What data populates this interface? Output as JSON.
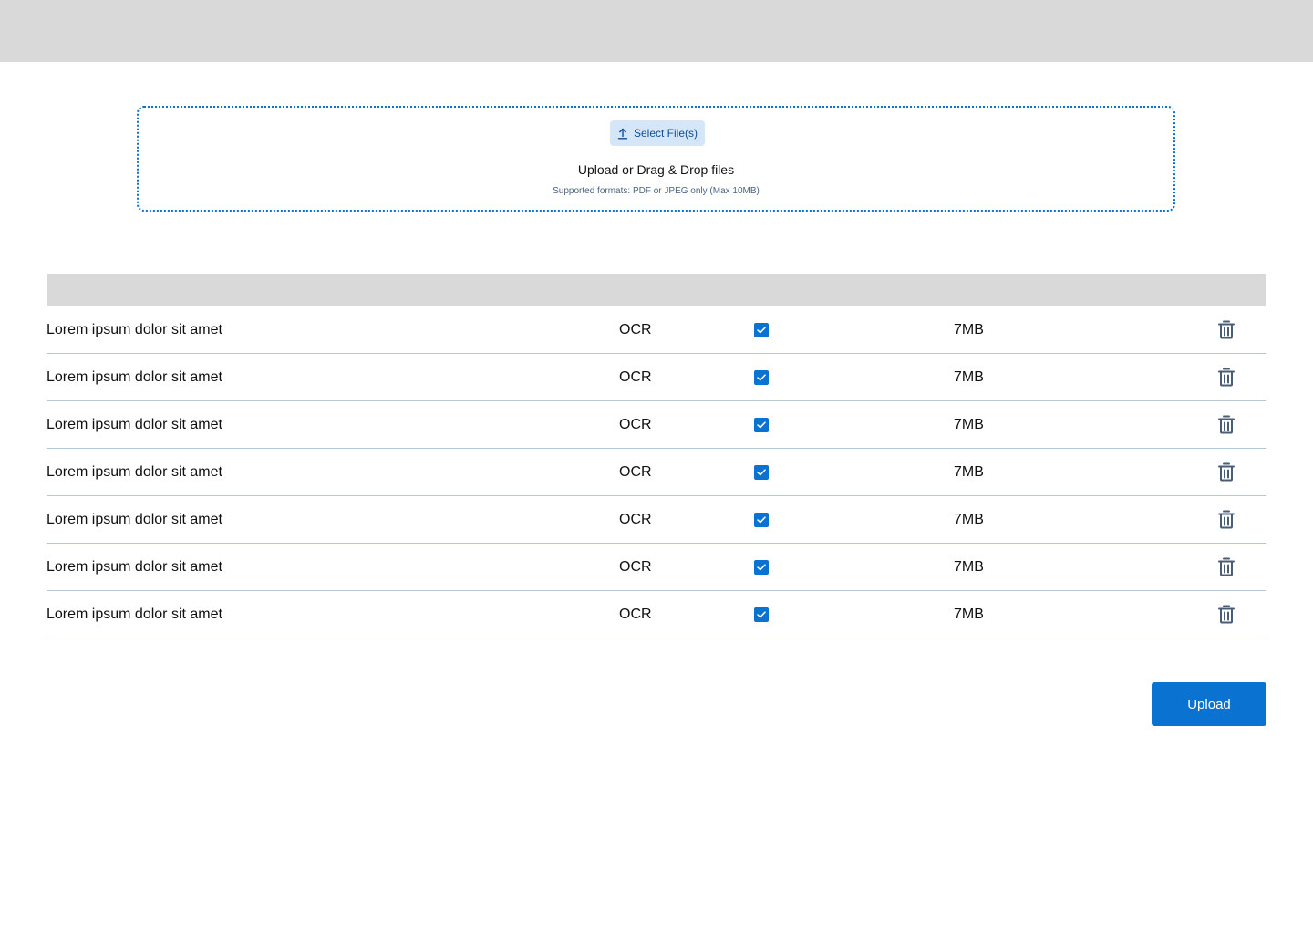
{
  "dropzone": {
    "select_label": "Select File(s)",
    "title": "Upload or Drag & Drop files",
    "hint": "Supported formats: PDF or JPEG only (Max 10MB)"
  },
  "files": [
    {
      "name": "Lorem ipsum dolor sit amet",
      "type": "OCR",
      "checked": true,
      "size": "7MB"
    },
    {
      "name": "Lorem ipsum dolor sit amet",
      "type": "OCR",
      "checked": true,
      "size": "7MB"
    },
    {
      "name": "Lorem ipsum dolor sit amet",
      "type": "OCR",
      "checked": true,
      "size": "7MB"
    },
    {
      "name": "Lorem ipsum dolor sit amet",
      "type": "OCR",
      "checked": true,
      "size": "7MB"
    },
    {
      "name": "Lorem ipsum dolor sit amet",
      "type": "OCR",
      "checked": true,
      "size": "7MB"
    },
    {
      "name": "Lorem ipsum dolor sit amet",
      "type": "OCR",
      "checked": true,
      "size": "7MB"
    },
    {
      "name": "Lorem ipsum dolor sit amet",
      "type": "OCR",
      "checked": true,
      "size": "7MB"
    }
  ],
  "icons": {
    "upload": "upload-arrow-icon",
    "check": "checkmark-icon",
    "delete": "trash-icon"
  },
  "colors": {
    "accent": "#0a72d1",
    "header_gray": "#d9d9d9",
    "select_button_bg": "#d5e6f8",
    "row_divider": "#b7c9d6",
    "trash_icon": "#4a5d77"
  },
  "actions": {
    "upload_label": "Upload"
  }
}
